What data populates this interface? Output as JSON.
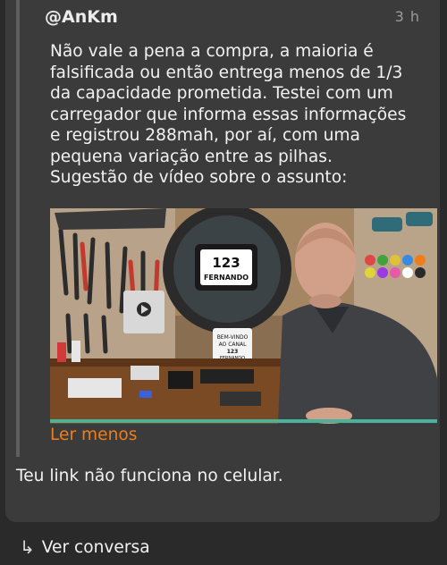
{
  "comment": {
    "author": "@AnKm",
    "time": "3 h",
    "text": "Não vale a pena a compra, a maioria é\nfalsificada ou então entrega menos de 1/3\nda capacidade prometida. Testei com um\ncarregador que informa essas informações\ne registrou 288mah, por aí, com uma\npequena variação entre as pilhas.\nSugestão de vídeo sobre o assunto:",
    "video": {
      "sign_text": "123\nFERNANDO",
      "welcome_sign": "BEM-VINDO\nAO CANAL\n123\nFERNANDO"
    },
    "read_less_label": "Ler menos"
  },
  "reply": {
    "text": "Teu link não funciona no celular."
  },
  "footer": {
    "view_conversation_label": "Ver conversa",
    "arrow_icon": "reply-arrow-icon"
  },
  "colors": {
    "accent": "#f07d1a",
    "card_bg": "#3b3b3b",
    "page_bg": "#2a2a2a",
    "progress": "#48b39a"
  }
}
